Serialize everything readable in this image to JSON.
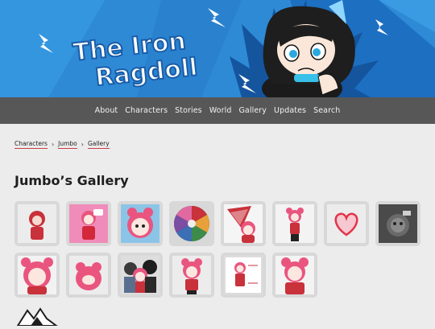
{
  "banner": {
    "title_line1": "The Iron",
    "title_line2": "Ragdoll",
    "bg_color": "#2f8ad6",
    "accent_color": "#1d6fc2"
  },
  "nav": {
    "items": [
      "About",
      "Characters",
      "Stories",
      "World",
      "Gallery",
      "Updates",
      "Search"
    ]
  },
  "breadcrumb": {
    "items": [
      "Characters",
      "Jumbo",
      "Gallery"
    ],
    "separator": "›"
  },
  "page": {
    "title": "Jumbo’s Gallery"
  },
  "gallery": {
    "thumbnails": [
      {
        "name": "gallery-thumb-1",
        "icon": "character-sketch"
      },
      {
        "name": "gallery-thumb-2",
        "icon": "character-pink-bg"
      },
      {
        "name": "gallery-thumb-3",
        "icon": "character-face"
      },
      {
        "name": "gallery-thumb-4",
        "icon": "color-wheel"
      },
      {
        "name": "gallery-thumb-5",
        "icon": "character-fan"
      },
      {
        "name": "gallery-thumb-6",
        "icon": "character-standing"
      },
      {
        "name": "gallery-thumb-7",
        "icon": "heart"
      },
      {
        "name": "gallery-thumb-8",
        "icon": "dark-photo"
      },
      {
        "name": "gallery-thumb-9",
        "icon": "character-shy"
      },
      {
        "name": "gallery-thumb-10",
        "icon": "character-blob"
      },
      {
        "name": "gallery-thumb-11",
        "icon": "character-group"
      },
      {
        "name": "gallery-thumb-12",
        "icon": "character-chibi"
      },
      {
        "name": "gallery-thumb-13",
        "icon": "character-card"
      },
      {
        "name": "gallery-thumb-14",
        "icon": "character-pose"
      }
    ]
  }
}
